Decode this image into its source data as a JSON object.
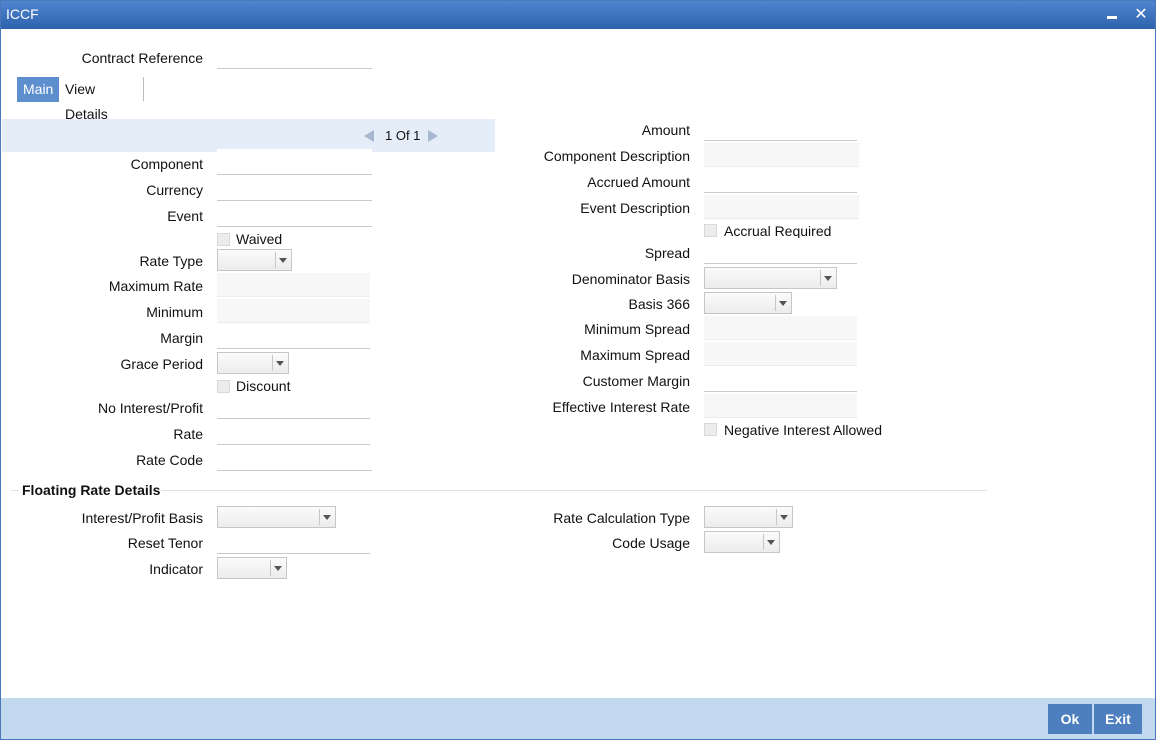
{
  "window": {
    "title": "ICCF"
  },
  "header": {
    "contract_reference_label": "Contract Reference",
    "contract_reference_value": ""
  },
  "tabs": [
    {
      "label": "Main"
    },
    {
      "label": "View Details"
    }
  ],
  "pager": {
    "text": "1 Of 1"
  },
  "left": {
    "component": "Component",
    "currency": "Currency",
    "event": "Event",
    "waived": "Waived",
    "rate_type": "Rate Type",
    "maximum_rate": "Maximum Rate",
    "minimum": "Minimum",
    "margin": "Margin",
    "grace_period": "Grace Period",
    "discount": "Discount",
    "no_interest": "No Interest/Profit",
    "rate": "Rate",
    "rate_code": "Rate Code"
  },
  "right": {
    "amount": "Amount",
    "component_description": "Component Description",
    "accrued_amount": "Accrued Amount",
    "event_description": "Event Description",
    "accrual_required": "Accrual Required",
    "spread": "Spread",
    "denominator_basis": "Denominator Basis",
    "basis_366": "Basis 366",
    "minimum_spread": "Minimum Spread",
    "maximum_spread": "Maximum Spread",
    "customer_margin": "Customer Margin",
    "effective_interest_rate": "Effective Interest Rate",
    "negative_interest_allowed": "Negative Interest Allowed"
  },
  "floating": {
    "title": "Floating Rate Details",
    "interest_profit_basis": "Interest/Profit Basis",
    "reset_tenor": "Reset Tenor",
    "indicator": "Indicator",
    "rate_calculation_type": "Rate Calculation Type",
    "code_usage": "Code Usage"
  },
  "footer": {
    "ok": "Ok",
    "exit": "Exit"
  },
  "colors": {
    "titlebar": "#3a6fbd",
    "footer": "#c2d8ee",
    "button": "#4d7fbe",
    "active_tab": "#5d8fcf"
  }
}
